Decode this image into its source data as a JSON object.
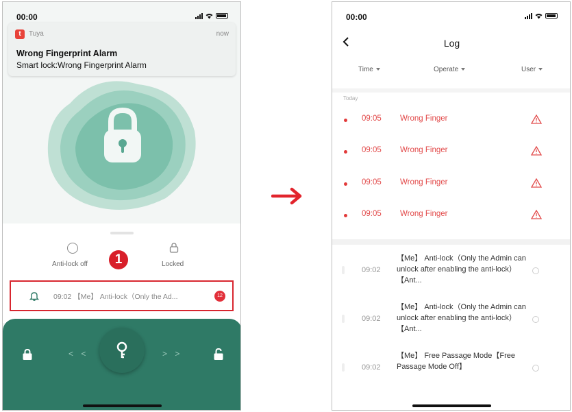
{
  "left": {
    "status": {
      "time": "00:00"
    },
    "notification": {
      "app": "Tuya",
      "icon_letter": "t",
      "when": "now",
      "title": "Wrong Fingerprint Alarm",
      "body": "Smart lock:Wrong Fingerprint Alarm"
    },
    "controls": {
      "anti_lock_label": "Anti-lock off",
      "locked_label": "Locked"
    },
    "step_badge": "1",
    "latest": {
      "text": "09:02 【Me】 Anti-lock（Only the Ad...",
      "count": "12"
    },
    "slider": {
      "left_arrows": "< <",
      "right_arrows": "> >"
    }
  },
  "right": {
    "status": {
      "time": "00:00"
    },
    "title": "Log",
    "filters": [
      "Time",
      "Operate",
      "User"
    ],
    "section": "Today",
    "alarms": [
      {
        "time": "09:05",
        "event": "Wrong Finger"
      },
      {
        "time": "09:05",
        "event": "Wrong Finger"
      },
      {
        "time": "09:05",
        "event": "Wrong Finger"
      },
      {
        "time": "09:05",
        "event": "Wrong Finger"
      }
    ],
    "records": [
      {
        "time": "09:02",
        "event": "【Me】 Anti-lock（Only the Admin can unlock after enabling the anti-lock）【Ant..."
      },
      {
        "time": "09:02",
        "event": "【Me】 Anti-lock（Only the Admin can unlock after enabling the anti-lock）【Ant..."
      },
      {
        "time": "09:02",
        "event": "【Me】 Free Passage Mode【Free Passage Mode Off】"
      }
    ]
  },
  "colors": {
    "teal": "#2f7a66",
    "alarm_red": "#e24b4b",
    "badge_red": "#d81f2a"
  }
}
